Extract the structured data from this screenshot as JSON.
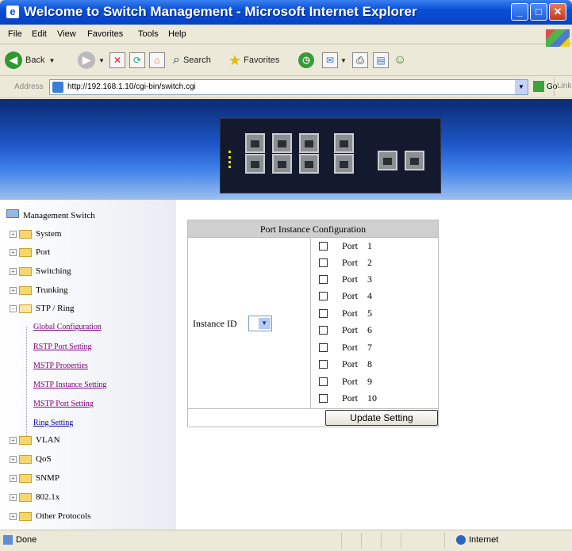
{
  "window": {
    "title": "Welcome to Switch Management - Microsoft Internet Explorer",
    "app_icon": "ie-icon"
  },
  "menu": [
    "File",
    "Edit",
    "View",
    "Favorites",
    "Tools",
    "Help"
  ],
  "toolbar": {
    "back": "Back",
    "search": "Search",
    "favorites": "Favorites"
  },
  "address": {
    "label": "Address",
    "url": "http://192.168.1.10/cgi-bin/switch.cgi",
    "go": "Go",
    "links": "Links"
  },
  "nav": {
    "root": "Management Switch",
    "items": [
      {
        "label": "System"
      },
      {
        "label": "Port"
      },
      {
        "label": "Switching"
      },
      {
        "label": "Trunking"
      },
      {
        "label": "STP / Ring"
      }
    ],
    "stp_children": [
      {
        "label": "Global Configuration"
      },
      {
        "label": "RSTP Port Setting"
      },
      {
        "label": "MSTP Properties"
      },
      {
        "label": "MSTP Instance Setting"
      },
      {
        "label": "MSTP Port Setting"
      },
      {
        "label": "Ring Setting"
      }
    ],
    "items2": [
      {
        "label": "VLAN"
      },
      {
        "label": "QoS"
      },
      {
        "label": "SNMP"
      },
      {
        "label": "802.1x"
      },
      {
        "label": "Other Protocols"
      }
    ]
  },
  "config": {
    "title": "Port Instance Configuration",
    "instance_label": "Instance ID",
    "ports": [
      {
        "label": "Port",
        "num": "1",
        "checked": false
      },
      {
        "label": "Port",
        "num": "2",
        "checked": false
      },
      {
        "label": "Port",
        "num": "3",
        "checked": false
      },
      {
        "label": "Port",
        "num": "4",
        "checked": false
      },
      {
        "label": "Port",
        "num": "5",
        "checked": false
      },
      {
        "label": "Port",
        "num": "6",
        "checked": false
      },
      {
        "label": "Port",
        "num": "7",
        "checked": false
      },
      {
        "label": "Port",
        "num": "8",
        "checked": false
      },
      {
        "label": "Port",
        "num": "9",
        "checked": false
      },
      {
        "label": "Port",
        "num": "10",
        "checked": false
      }
    ],
    "update_button": "Update Setting"
  },
  "status": {
    "left": "Done",
    "zone": "Internet"
  }
}
